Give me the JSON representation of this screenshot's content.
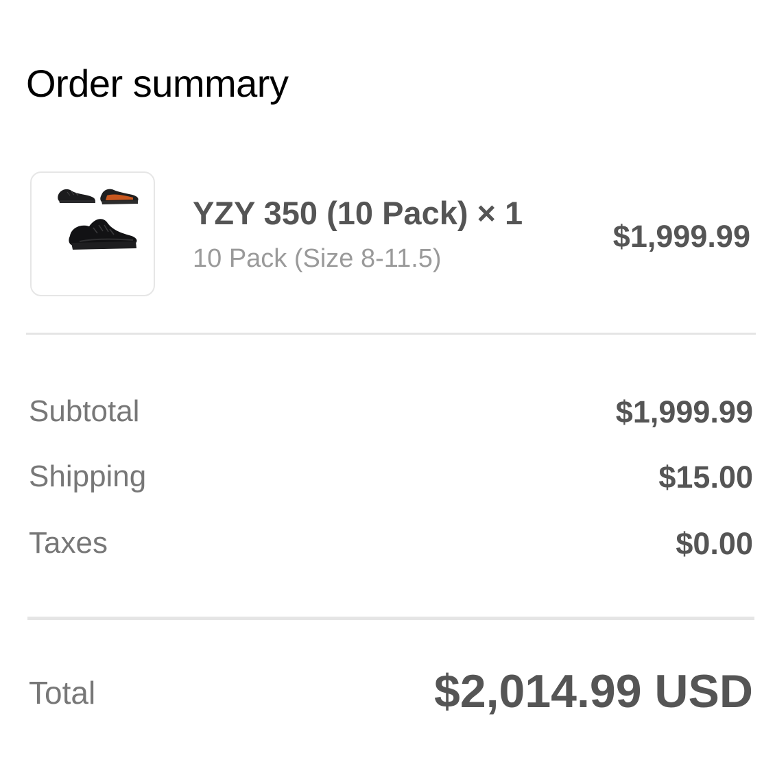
{
  "header": {
    "title": "Order summary"
  },
  "line_item": {
    "image_icon": "sneaker-product-thumbnail",
    "name": "YZY 350 (10 Pack) × 1",
    "variant": "10 Pack (Size 8-11.5)",
    "price": "$1,999.99"
  },
  "costs": [
    {
      "label": "Subtotal",
      "value": "$1,999.99"
    },
    {
      "label": "Shipping",
      "value": "$15.00"
    },
    {
      "label": "Taxes",
      "value": "$0.00"
    }
  ],
  "total": {
    "label": "Total",
    "value": "$2,014.99 USD"
  },
  "colors": {
    "title": "#000000",
    "text": "#555555",
    "muted": "#777777",
    "divider": "#e5e5e5"
  }
}
